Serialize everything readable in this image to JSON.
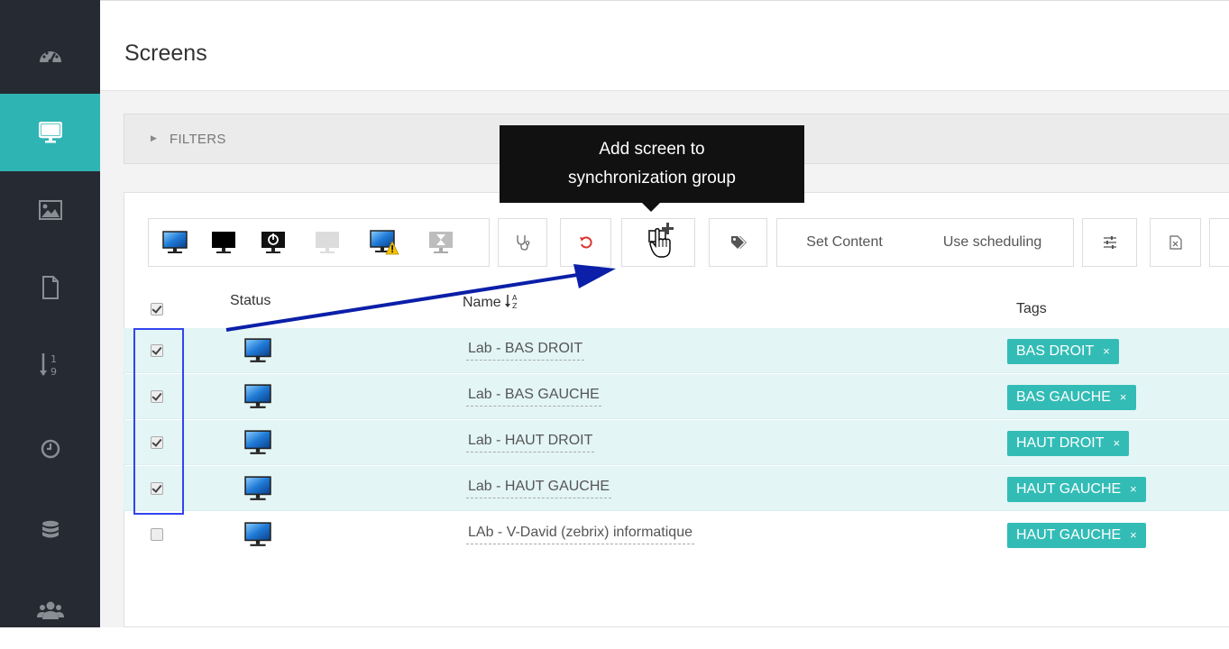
{
  "sidebar": {
    "items": [
      {
        "icon": "dashboard-gauge-icon"
      },
      {
        "icon": "monitor-icon",
        "active": true
      },
      {
        "icon": "image-icon"
      },
      {
        "icon": "document-icon"
      },
      {
        "icon": "sort-numeric-icon"
      },
      {
        "icon": "clock-icon"
      },
      {
        "icon": "database-icon"
      },
      {
        "icon": "users-icon"
      }
    ]
  },
  "page": {
    "title": "Screens"
  },
  "filters": {
    "label": "FILTERS"
  },
  "toolbar": {
    "set_content_label": "Set Content",
    "use_scheduling_label": "Use scheduling"
  },
  "tooltip": {
    "line1": "Add screen to",
    "line2": "synchronization group"
  },
  "table": {
    "columns": {
      "status": "Status",
      "name": "Name",
      "tags": "Tags"
    },
    "rows": [
      {
        "name": "Lab - BAS DROIT",
        "tag": "BAS DROIT",
        "checked": true
      },
      {
        "name": "Lab - BAS GAUCHE",
        "tag": "BAS GAUCHE",
        "checked": true
      },
      {
        "name": "Lab - HAUT DROIT",
        "tag": "HAUT DROIT",
        "checked": true
      },
      {
        "name": "Lab - HAUT GAUCHE",
        "tag": "HAUT GAUCHE",
        "checked": true
      },
      {
        "name": "LAb - V-David (zebrix) informatique",
        "tag": "HAUT GAUCHE",
        "checked": false
      }
    ],
    "tag_remove_glyph": "×"
  },
  "colors": {
    "accent": "#2fb4b4",
    "sidebar": "#262a33",
    "tag": "#33bcb6",
    "annotation": "#3344ee",
    "arrow": "#0b1fa8"
  }
}
